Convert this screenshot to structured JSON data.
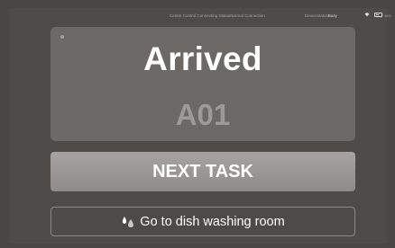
{
  "status_bar": {
    "connection_text": "Center Control Connecting StatusNormal Connection",
    "device_text": "Devicestatus",
    "device_status": "Busy",
    "wifi_icon": "wifi-icon",
    "battery_icon": "battery-icon",
    "battery_text": "48%"
  },
  "card": {
    "status_title": "Arrived",
    "location_code": "A01"
  },
  "actions": {
    "next_task_label": "NEXT TASK",
    "destination_label": "Go to dish washing room",
    "destination_icon": "water-drops-icon"
  },
  "colors": {
    "background": "#4a4643",
    "card": "#6b6866",
    "primary_button": "#9a9896",
    "text_primary": "#ffffff",
    "text_muted": "#9c9a98"
  }
}
